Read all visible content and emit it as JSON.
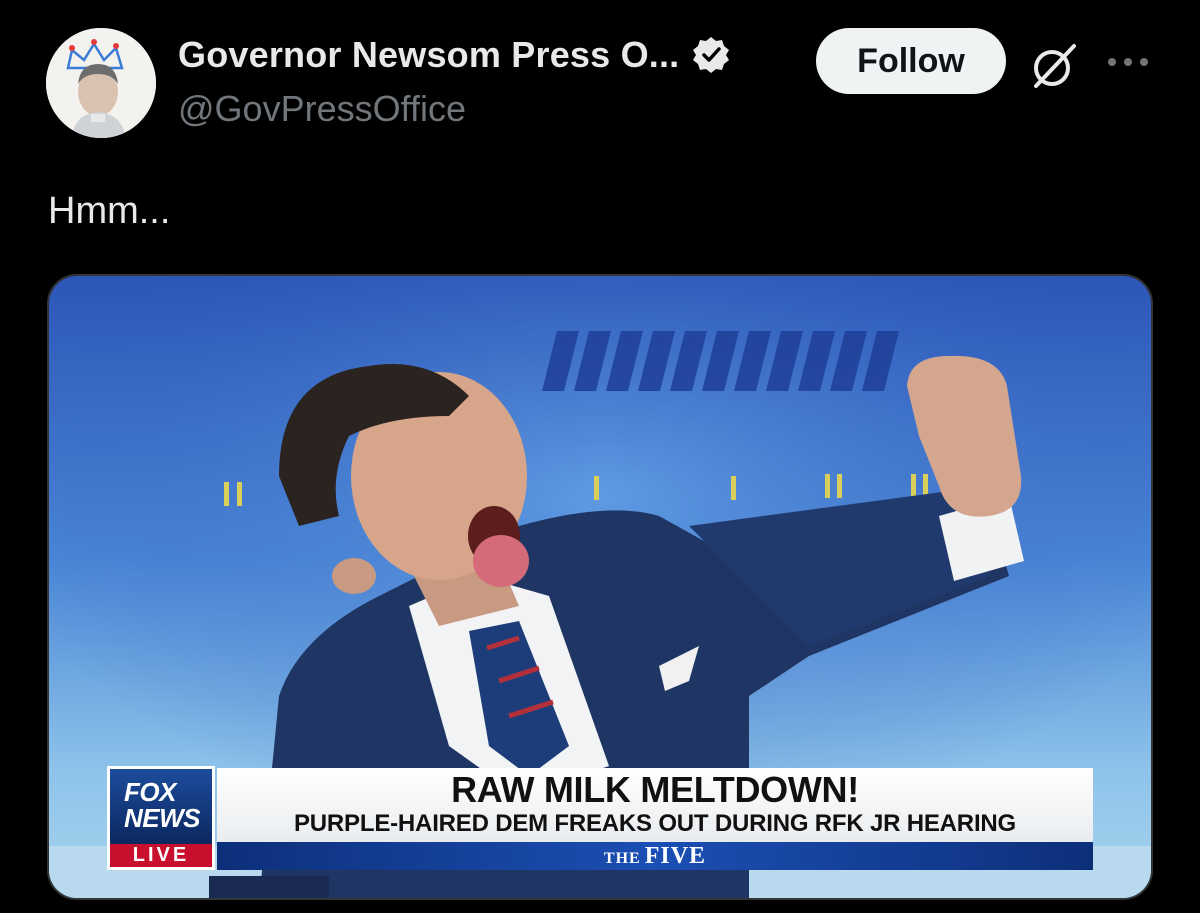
{
  "post": {
    "author": {
      "display_name": "Governor Newsom Press O...",
      "handle": "@GovPressOffice",
      "verified": true
    },
    "follow_label": "Follow",
    "text": "Hmm...",
    "icons": {
      "verified": "verified-badge-icon",
      "grok": "grok-icon",
      "more": "more-options-icon"
    }
  },
  "media": {
    "network_logo_top": "FOX NEWS",
    "network_logo_bottom": "LIVE",
    "headline": "RAW MILK MELTDOWN!",
    "subhead": "PURPLE-HAIRED DEM FREAKS OUT DURING RFK JR HEARING",
    "show_prefix": "THE",
    "show_name": "FIVE"
  },
  "colors": {
    "background": "#000000",
    "primary_text": "#e7e9ea",
    "secondary_text": "#71767b",
    "follow_bg": "#eff3f4",
    "verified": "#1d9bf0",
    "fox_red": "#c8102e",
    "fox_blue": "#0d2c6b"
  }
}
